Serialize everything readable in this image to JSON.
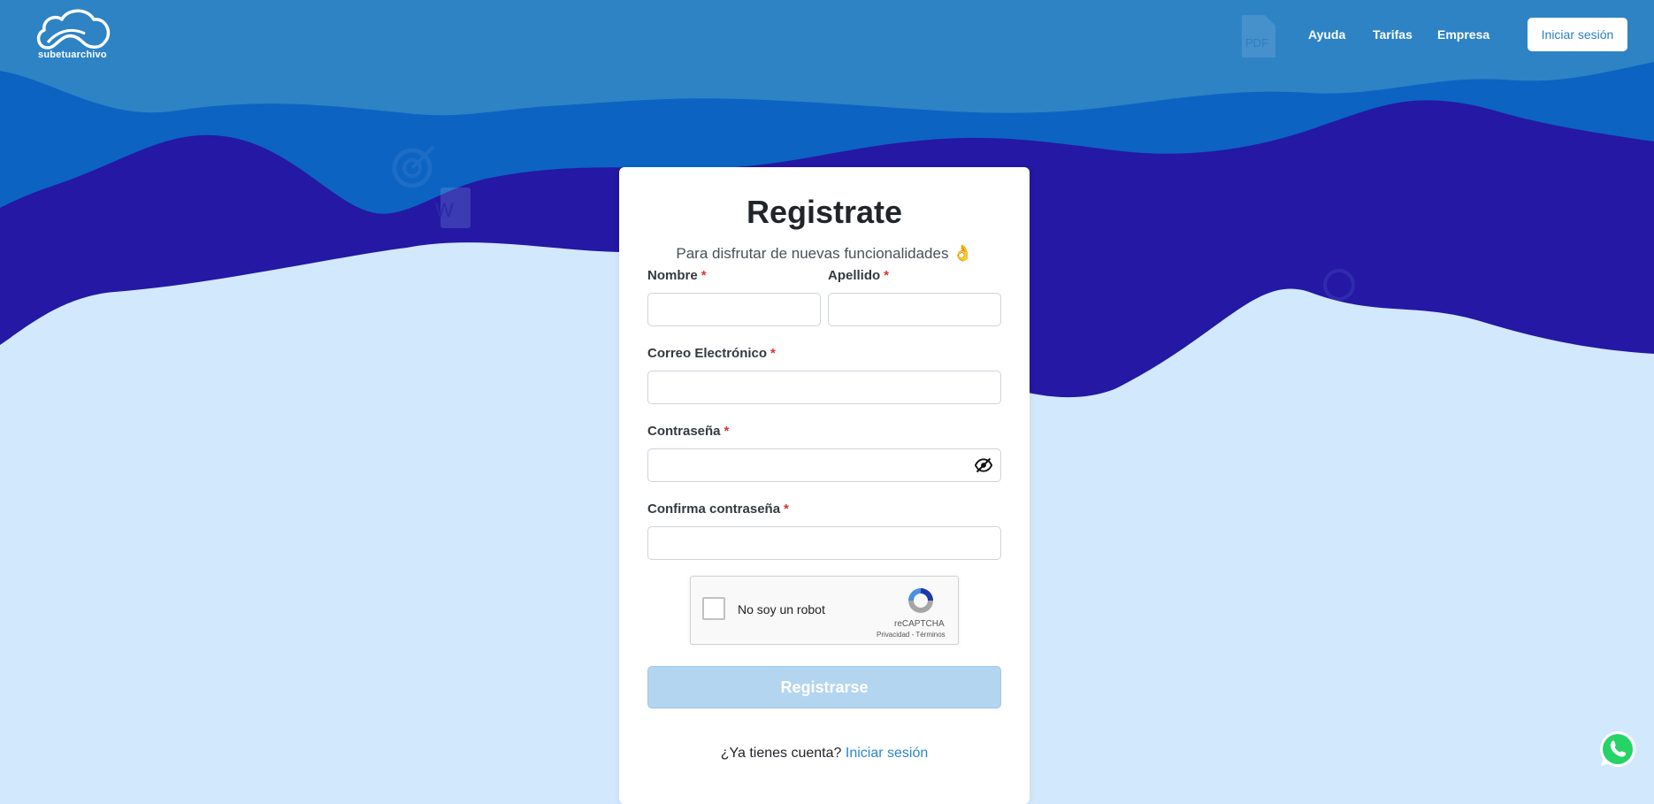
{
  "header": {
    "logo_text": "subetuarchivo",
    "nav": [
      "Ayuda",
      "Tarifas",
      "Empresa"
    ],
    "login_label": "Iniciar sesión"
  },
  "decor": {
    "pdf_label": "PDF",
    "word_label": "W"
  },
  "form": {
    "title": "Registrate",
    "subtitle": "Para disfrutar de nuevas funcionalidades",
    "subtitle_emoji": "👌",
    "required_mark": "*",
    "fields": {
      "nombre": {
        "label": "Nombre",
        "value": ""
      },
      "apellido": {
        "label": "Apellido",
        "value": ""
      },
      "correo": {
        "label": "Correo Electrónico",
        "value": ""
      },
      "contrasena": {
        "label": "Contraseña",
        "value": ""
      },
      "confirma": {
        "label": "Confirma contraseña",
        "value": ""
      }
    },
    "captcha": {
      "label": "No soy un robot",
      "brand": "reCAPTCHA",
      "links": "Privacidad - Términos"
    },
    "submit_label": "Registrarse",
    "account_prompt": "¿Ya tienes cuenta?",
    "login_link": "Iniciar sesión"
  },
  "colors": {
    "wave_top": "#2e83c5",
    "wave_mid": "#0c63c2",
    "wave_dark": "#2418a4",
    "background": "#d2e8fc",
    "accent": "#2b86cf",
    "submit_disabled": "#b3d5f0"
  },
  "icons": {
    "eye": "eye-off-icon",
    "whatsapp": "whatsapp-icon",
    "logo": "cloud-logo-icon"
  }
}
